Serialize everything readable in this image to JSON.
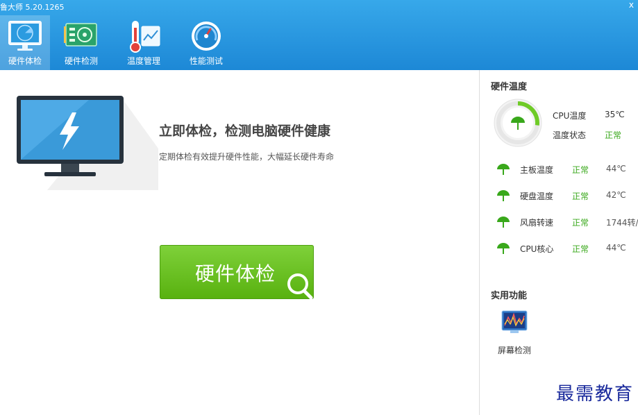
{
  "app": {
    "title": "鲁大师 5.20.1265",
    "close_glyph": "x"
  },
  "nav": [
    {
      "label": "硬件体检",
      "icon": "monitor-radar-icon",
      "active": true
    },
    {
      "label": "硬件检测",
      "icon": "circuit-board-icon",
      "active": false
    },
    {
      "label": "温度管理",
      "icon": "thermometer-icon",
      "active": false
    },
    {
      "label": "性能测试",
      "icon": "speedometer-icon",
      "active": false
    }
  ],
  "main": {
    "headline": "立即体检，检测电脑硬件健康",
    "subline": "定期体检有效提升硬件性能，大幅延长硬件寿命",
    "check_button": "硬件体检",
    "monitor_icon": "monitor-lightning-icon"
  },
  "sidebar": {
    "temp_title": "硬件温度",
    "cpu": {
      "label": "CPU温度",
      "value": "35℃",
      "status_label": "温度状态",
      "status": "正常",
      "gauge_fraction": 0.27
    },
    "rows": [
      {
        "label": "主板温度",
        "status": "正常",
        "value": "44℃"
      },
      {
        "label": "硬盘温度",
        "status": "正常",
        "value": "42℃"
      },
      {
        "label": "风扇转速",
        "status": "正常",
        "value": "1744转/"
      },
      {
        "label": "CPU核心",
        "status": "正常",
        "value": "44℃"
      }
    ],
    "tools_title": "实用功能",
    "tools": [
      {
        "label": "屏幕检测",
        "icon": "screen-test-icon"
      }
    ]
  },
  "watermark": "最需教育",
  "colors": {
    "header": "#2496df",
    "accent_green": "#39a81b",
    "button_green": "#6bc226"
  }
}
